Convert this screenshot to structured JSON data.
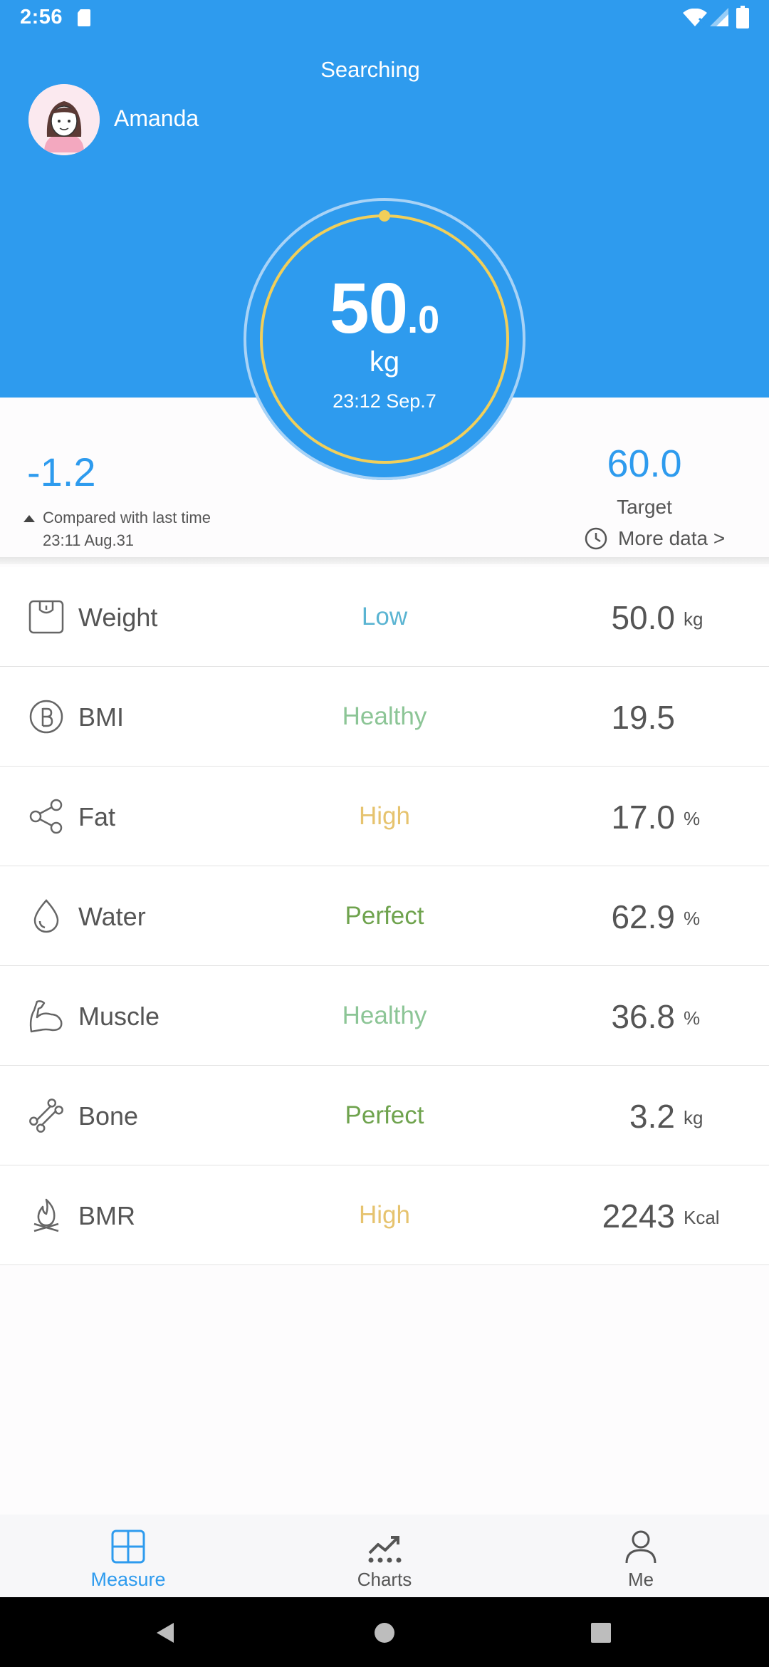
{
  "status_bar": {
    "time": "2:56"
  },
  "header": {
    "status_text": "Searching",
    "user_name": "Amanda"
  },
  "gauge": {
    "weight_int": "50",
    "weight_dec": ".0",
    "unit": "kg",
    "measured_at": "23:12 Sep.7"
  },
  "comparison": {
    "difference": "-1.2",
    "caption": "Compared with last time",
    "last_time": "23:11 Aug.31"
  },
  "target": {
    "value": "60.0",
    "label": "Target",
    "more_data": "More data >"
  },
  "metrics": [
    {
      "name": "Weight",
      "status": "Low",
      "status_color": "#5ab4d2",
      "value": "50.0",
      "unit": "kg",
      "icon": "scale-icon"
    },
    {
      "name": "BMI",
      "status": "Healthy",
      "status_color": "#8cc596",
      "value": "19.5",
      "unit": "",
      "icon": "bmi-icon"
    },
    {
      "name": "Fat",
      "status": "High",
      "status_color": "#e6c36e",
      "value": "17.0",
      "unit": "%",
      "icon": "share-nodes-icon"
    },
    {
      "name": "Water",
      "status": "Perfect",
      "status_color": "#6fa34e",
      "value": "62.9",
      "unit": "%",
      "icon": "water-drop-icon"
    },
    {
      "name": "Muscle",
      "status": "Healthy",
      "status_color": "#8cc596",
      "value": "36.8",
      "unit": "%",
      "icon": "muscle-icon"
    },
    {
      "name": "Bone",
      "status": "Perfect",
      "status_color": "#6fa34e",
      "value": "3.2",
      "unit": "kg",
      "icon": "bone-icon"
    },
    {
      "name": "BMR",
      "status": "High",
      "status_color": "#e6c36e",
      "value": "2243",
      "unit": "Kcal",
      "icon": "flame-icon"
    }
  ],
  "bottom_nav": [
    {
      "label": "Measure",
      "active": true,
      "icon": "grid-icon"
    },
    {
      "label": "Charts",
      "active": false,
      "icon": "trend-chart-icon"
    },
    {
      "label": "Me",
      "active": false,
      "icon": "person-icon"
    }
  ],
  "colors": {
    "accent": "#2e9bee",
    "gauge_ring": "#f1cf5a"
  }
}
